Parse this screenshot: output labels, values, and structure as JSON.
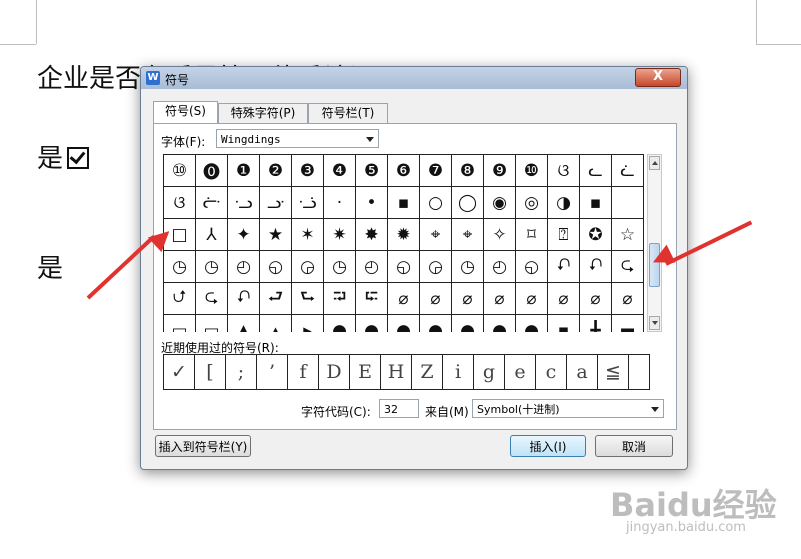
{
  "document": {
    "line1": "企业是否有质量管理体系认证？",
    "line2": "是",
    "line3": "是"
  },
  "dialog": {
    "title": "符号",
    "close_label": "X",
    "tabs": [
      {
        "label": "符号(S)",
        "active": true
      },
      {
        "label": "特殊字符(P)",
        "active": false
      },
      {
        "label": "符号栏(T)",
        "active": false
      }
    ],
    "font_label": "字体(F):",
    "font_value": "Wingdings",
    "symbols": [
      "⑩",
      "⓿",
      "❶",
      "❷",
      "❸",
      "❹",
      "❺",
      "❻",
      "❼",
      "❽",
      "❾",
      "❿",
      "ଓ",
      "ᓚ",
      "ᓛ",
      "ଓ",
      "ᓡ",
      "ᓢ",
      "ᓣ",
      "ᓤ",
      "·",
      "•",
      "▪",
      "○",
      "◯",
      "◉",
      "◎",
      "◑",
      "▪",
      "",
      "□",
      "⅄",
      "✦",
      "★",
      "✶",
      "✷",
      "✸",
      "✹",
      "⌖",
      "⌖",
      "✧",
      "⌑",
      "⍰",
      "✪",
      "☆",
      "◷",
      "◷",
      "◴",
      "◵",
      "◶",
      "◷",
      "◴",
      "◵",
      "◶",
      "◷",
      "◴",
      "◵",
      "⮏",
      "⮏",
      "⮎",
      "⮍",
      "⮎",
      "⮏",
      "⮐",
      "⮑",
      "⮒",
      "⮓",
      "⌀",
      "⌀",
      "⌀",
      "⌀",
      "⌀",
      "⌀",
      "⌀",
      "⌀",
      "▭",
      "▭",
      "▲",
      "▴",
      "▸",
      "●",
      "●",
      "●",
      "●",
      "●",
      "●",
      "●",
      "▪",
      "╋",
      "▬"
    ],
    "recent_label": "近期使用过的符号(R):",
    "recent_symbols": [
      "✓",
      "[",
      ";",
      "’",
      "f",
      "D",
      "E",
      "H",
      "Z",
      "i",
      "g",
      "e",
      "c",
      "a",
      "≦",
      ""
    ],
    "char_code_label": "字符代码(C):",
    "char_code_value": "32",
    "from_label": "来自(M)",
    "from_value": "Symbol(十进制)",
    "insert_to_bar_label": "插入到符号栏(Y)",
    "insert_label": "插入(I)",
    "cancel_label": "取消"
  },
  "watermark": {
    "brand": "Baidu经验",
    "url": "jingyan.baidu.com"
  },
  "colors": {
    "annotation_arrow": "#e0322f",
    "title_bar": "#b7c9df",
    "close_button": "#c7462b"
  }
}
